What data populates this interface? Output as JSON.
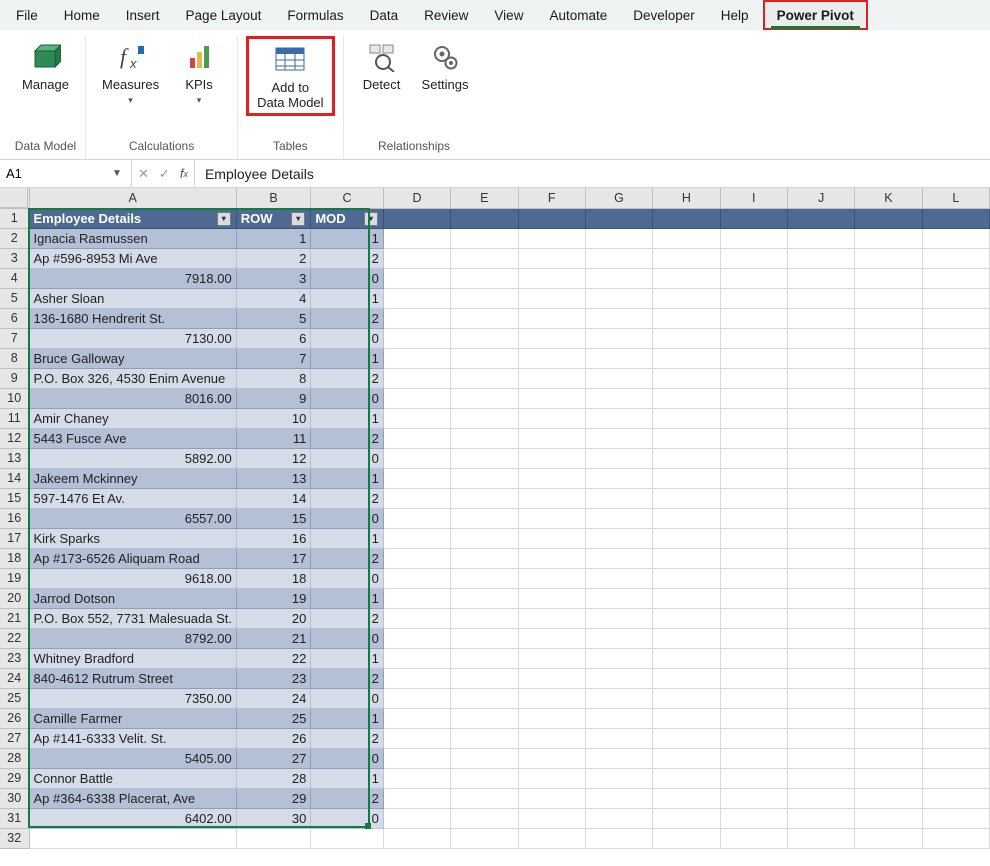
{
  "menu": [
    "File",
    "Home",
    "Insert",
    "Page Layout",
    "Formulas",
    "Data",
    "Review",
    "View",
    "Automate",
    "Developer",
    "Help",
    "Power Pivot"
  ],
  "menu_highlight": "Power Pivot",
  "ribbon": {
    "groups": [
      {
        "label": "Data Model",
        "buttons": [
          {
            "id": "manage",
            "label1": "Manage",
            "label2": "",
            "icon": "cube",
            "drop": false
          }
        ]
      },
      {
        "label": "Calculations",
        "buttons": [
          {
            "id": "measures",
            "label1": "Measures",
            "label2": "",
            "icon": "fx",
            "drop": true
          },
          {
            "id": "kpis",
            "label1": "KPIs",
            "label2": "",
            "icon": "kpi",
            "drop": true
          }
        ]
      },
      {
        "label": "Tables",
        "buttons": [
          {
            "id": "add-to-dm",
            "label1": "Add to",
            "label2": "Data Model",
            "icon": "table",
            "drop": false,
            "hl": true
          }
        ]
      },
      {
        "label": "Relationships",
        "buttons": [
          {
            "id": "detect",
            "label1": "Detect",
            "label2": "",
            "icon": "detect",
            "drop": false
          },
          {
            "id": "settings",
            "label1": "Settings",
            "label2": "",
            "icon": "gear",
            "drop": false
          }
        ]
      }
    ]
  },
  "namebox": "A1",
  "formula": "Employee Details",
  "columns": [
    "A",
    "B",
    "C",
    "D",
    "E",
    "F",
    "G",
    "H",
    "I",
    "J",
    "K",
    "L"
  ],
  "table": {
    "headers": [
      "Employee Details",
      "ROW",
      "MOD"
    ],
    "rows": [
      {
        "a": "Ignacia Rasmussen",
        "b": "1",
        "c": "1"
      },
      {
        "a": "Ap #596-8953 Mi Ave",
        "b": "2",
        "c": "2"
      },
      {
        "a": "7918.00",
        "ra": true,
        "b": "3",
        "c": "0"
      },
      {
        "a": "Asher Sloan",
        "b": "4",
        "c": "1"
      },
      {
        "a": "136-1680 Hendrerit St.",
        "b": "5",
        "c": "2"
      },
      {
        "a": "7130.00",
        "ra": true,
        "b": "6",
        "c": "0"
      },
      {
        "a": "Bruce Galloway",
        "b": "7",
        "c": "1"
      },
      {
        "a": "P.O. Box 326, 4530 Enim Avenue",
        "b": "8",
        "c": "2"
      },
      {
        "a": "8016.00",
        "ra": true,
        "b": "9",
        "c": "0"
      },
      {
        "a": "Amir Chaney",
        "b": "10",
        "c": "1"
      },
      {
        "a": "5443 Fusce Ave",
        "b": "11",
        "c": "2"
      },
      {
        "a": "5892.00",
        "ra": true,
        "b": "12",
        "c": "0"
      },
      {
        "a": "Jakeem Mckinney",
        "b": "13",
        "c": "1"
      },
      {
        "a": "597-1476 Et Av.",
        "b": "14",
        "c": "2"
      },
      {
        "a": "6557.00",
        "ra": true,
        "b": "15",
        "c": "0"
      },
      {
        "a": "Kirk Sparks",
        "b": "16",
        "c": "1"
      },
      {
        "a": "Ap #173-6526 Aliquam Road",
        "b": "17",
        "c": "2"
      },
      {
        "a": "9618.00",
        "ra": true,
        "b": "18",
        "c": "0"
      },
      {
        "a": "Jarrod Dotson",
        "b": "19",
        "c": "1"
      },
      {
        "a": "P.O. Box 552, 7731 Malesuada St.",
        "b": "20",
        "c": "2"
      },
      {
        "a": "8792.00",
        "ra": true,
        "b": "21",
        "c": "0"
      },
      {
        "a": "Whitney Bradford",
        "b": "22",
        "c": "1"
      },
      {
        "a": "840-4612 Rutrum Street",
        "b": "23",
        "c": "2"
      },
      {
        "a": "7350.00",
        "ra": true,
        "b": "24",
        "c": "0"
      },
      {
        "a": "Camille Farmer",
        "b": "25",
        "c": "1"
      },
      {
        "a": "Ap #141-6333 Velit. St.",
        "b": "26",
        "c": "2"
      },
      {
        "a": "5405.00",
        "ra": true,
        "b": "27",
        "c": "0"
      },
      {
        "a": "Connor Battle",
        "b": "28",
        "c": "1"
      },
      {
        "a": "Ap #364-6338 Placerat, Ave",
        "b": "29",
        "c": "2"
      },
      {
        "a": "6402.00",
        "ra": true,
        "b": "30",
        "c": "0"
      }
    ]
  },
  "empty_rows": [
    "32"
  ]
}
